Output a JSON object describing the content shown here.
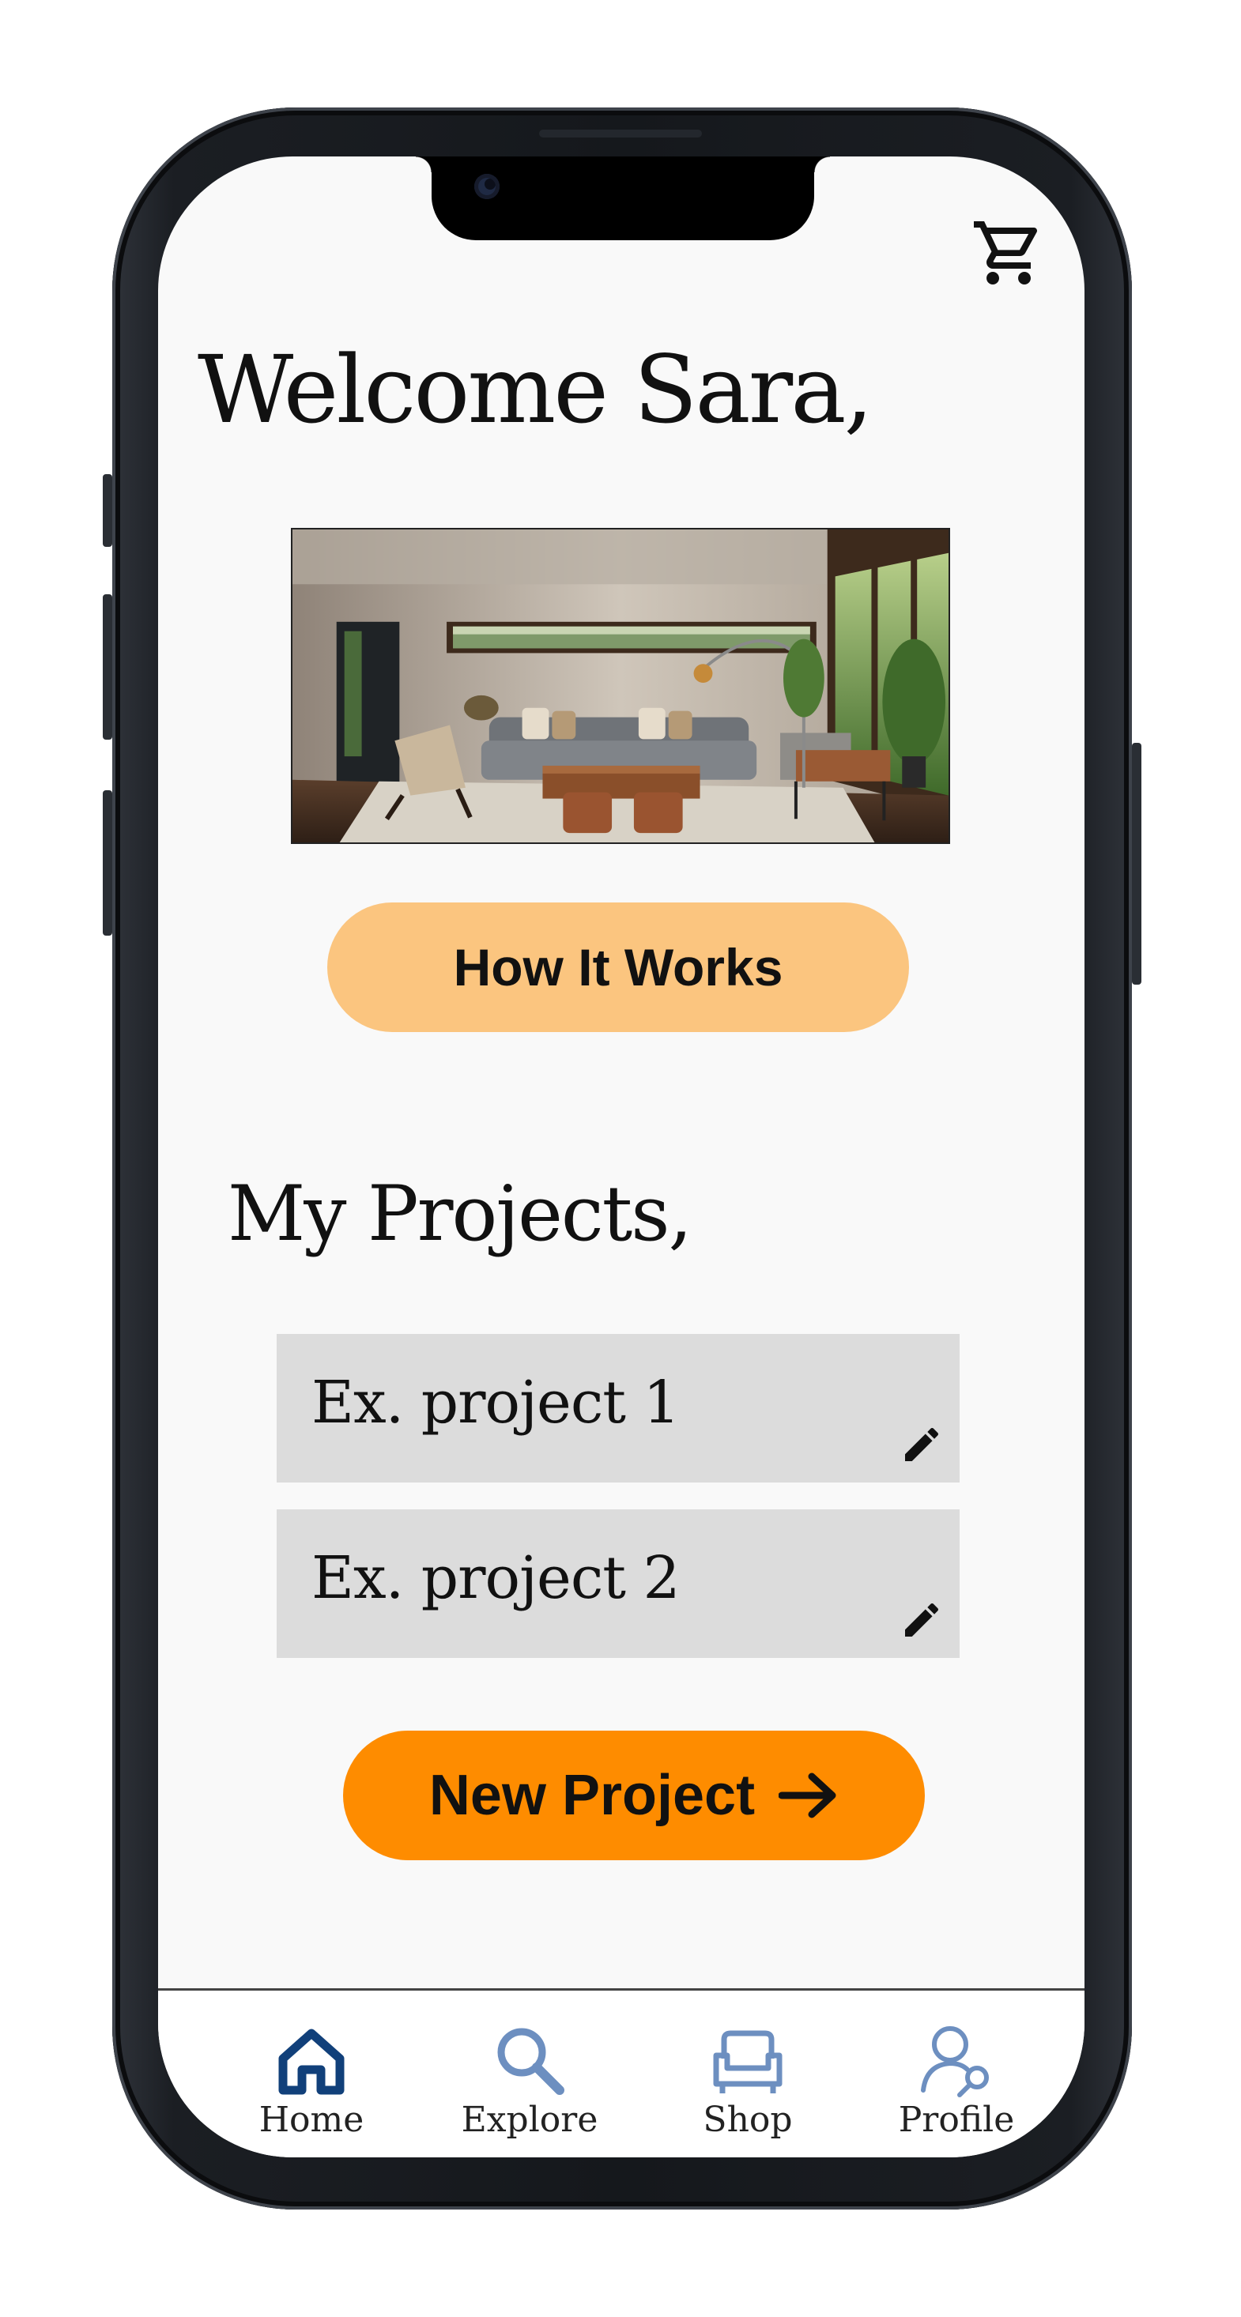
{
  "header": {
    "greeting": "Welcome Sara,",
    "cart_icon": "shopping-cart-icon"
  },
  "hero": {
    "image": "living-room-photo"
  },
  "how_it_works": {
    "label": "How It Works",
    "color": "#fbc57f"
  },
  "projects": {
    "title": "My Projects,",
    "items": [
      {
        "name": "Ex. project 1",
        "icon": "pencil-edit-icon"
      },
      {
        "name": "Ex. project 2",
        "icon": "pencil-edit-icon"
      }
    ]
  },
  "new_project": {
    "label": "New Project",
    "icon": "arrow-right-icon",
    "color": "#fe8c00"
  },
  "tab_bar": {
    "items": [
      {
        "label": "Home",
        "icon": "home-icon",
        "active": true
      },
      {
        "label": "Explore",
        "icon": "search-icon",
        "active": false
      },
      {
        "label": "Shop",
        "icon": "sofa-icon",
        "active": false
      },
      {
        "label": "Profile",
        "icon": "profile-search-icon",
        "active": false
      }
    ],
    "active_color": "#11407a",
    "inactive_color": "#6d8fc0"
  }
}
